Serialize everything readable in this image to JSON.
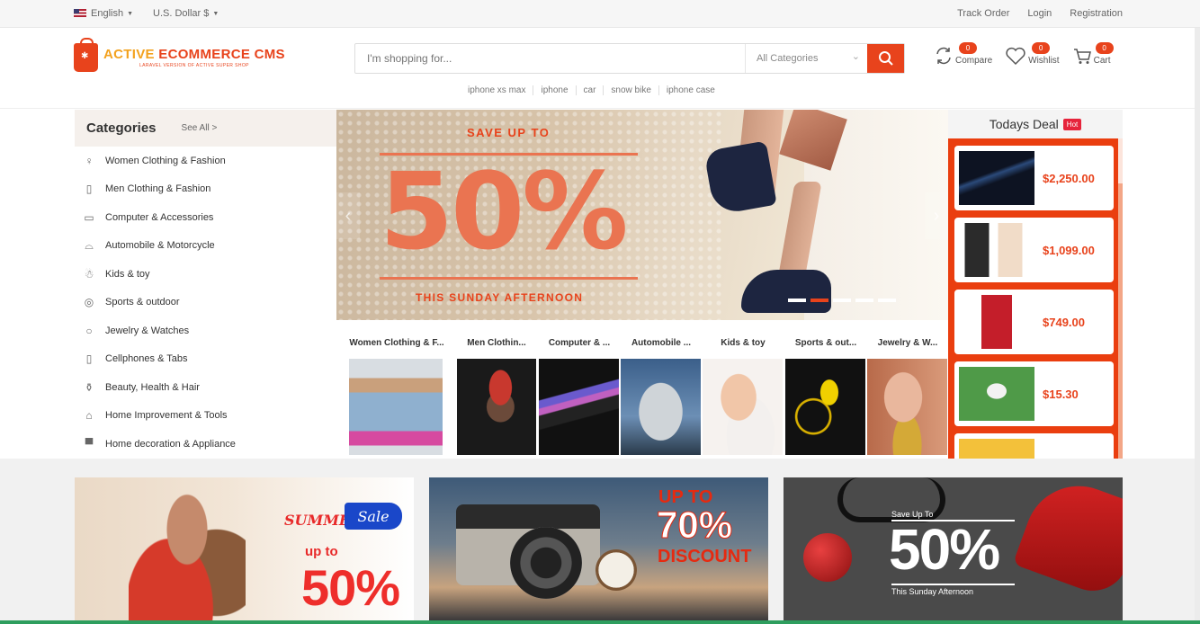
{
  "topbar": {
    "language": "English",
    "currency": "U.S. Dollar $",
    "track_order": "Track Order",
    "login": "Login",
    "registration": "Registration"
  },
  "logo": {
    "main_a": "ACTIVE ",
    "main_b": "ECOMMERCE CMS",
    "sub": "LARAVEL VERSION OF ACTIVE SUPER SHOP"
  },
  "search": {
    "placeholder": "I'm shopping for...",
    "category": "All Categories",
    "tags": [
      "iphone xs max",
      "iphone",
      "car",
      "snow bike",
      "iphone case"
    ]
  },
  "header_actions": {
    "compare_label": "Compare",
    "compare_count": "0",
    "wishlist_label": "Wishlist",
    "wishlist_count": "0",
    "cart_label": "Cart",
    "cart_count": "0"
  },
  "categories": {
    "title": "Categories",
    "see_all": "See All >",
    "items": [
      {
        "label": "Women Clothing & Fashion",
        "icon": "dress-icon"
      },
      {
        "label": "Men Clothing & Fashion",
        "icon": "shirt-icon"
      },
      {
        "label": "Computer & Accessories",
        "icon": "computer-icon"
      },
      {
        "label": "Automobile & Motorcycle",
        "icon": "car-icon"
      },
      {
        "label": "Kids & toy",
        "icon": "toy-icon"
      },
      {
        "label": "Sports & outdoor",
        "icon": "ball-icon"
      },
      {
        "label": "Jewelry & Watches",
        "icon": "ring-icon"
      },
      {
        "label": "Cellphones & Tabs",
        "icon": "phone-icon"
      },
      {
        "label": "Beauty, Health & Hair",
        "icon": "beauty-icon"
      },
      {
        "label": "Home Improvement & Tools",
        "icon": "home-icon"
      },
      {
        "label": "Home decoration & Appliance",
        "icon": "paint-icon"
      }
    ]
  },
  "slider": {
    "headline": "SAVE UP TO",
    "percent": "50%",
    "subline": "THIS SUNDAY AFTERNOON",
    "slide_count": 5,
    "active_slide": 2
  },
  "category_strip": [
    {
      "label": "Women Clothing & F..."
    },
    {
      "label": "Men Clothin..."
    },
    {
      "label": "Computer & ..."
    },
    {
      "label": "Automobile ..."
    },
    {
      "label": "Kids & toy"
    },
    {
      "label": "Sports & out..."
    },
    {
      "label": "Jewelry & W..."
    }
  ],
  "todays_deal": {
    "title": "Todays Deal",
    "badge": "Hot",
    "items": [
      {
        "price": "$2,250.00",
        "thumb": "laptop"
      },
      {
        "price": "$1,099.00",
        "thumb": "iphone-gold"
      },
      {
        "price": "$749.00",
        "thumb": "iphone-red"
      },
      {
        "price": "$15.30",
        "thumb": "kid-clothing"
      },
      {
        "price": "",
        "thumb": "kid-yellow"
      }
    ]
  },
  "banners": {
    "b1": {
      "summer": "SUMMER",
      "sale": "Sale",
      "upto": "up to",
      "percent": "50%"
    },
    "b2": {
      "upto": "UP TO",
      "percent": "70%",
      "discount": "DISCOUNT"
    },
    "b3": {
      "save": "Save Up To",
      "percent": "50%",
      "sub": "This Sunday Afternoon"
    }
  },
  "colors": {
    "brand": "#e8431c",
    "deal_bg": "#ea3e0f",
    "hot_badge": "#e6233b"
  }
}
